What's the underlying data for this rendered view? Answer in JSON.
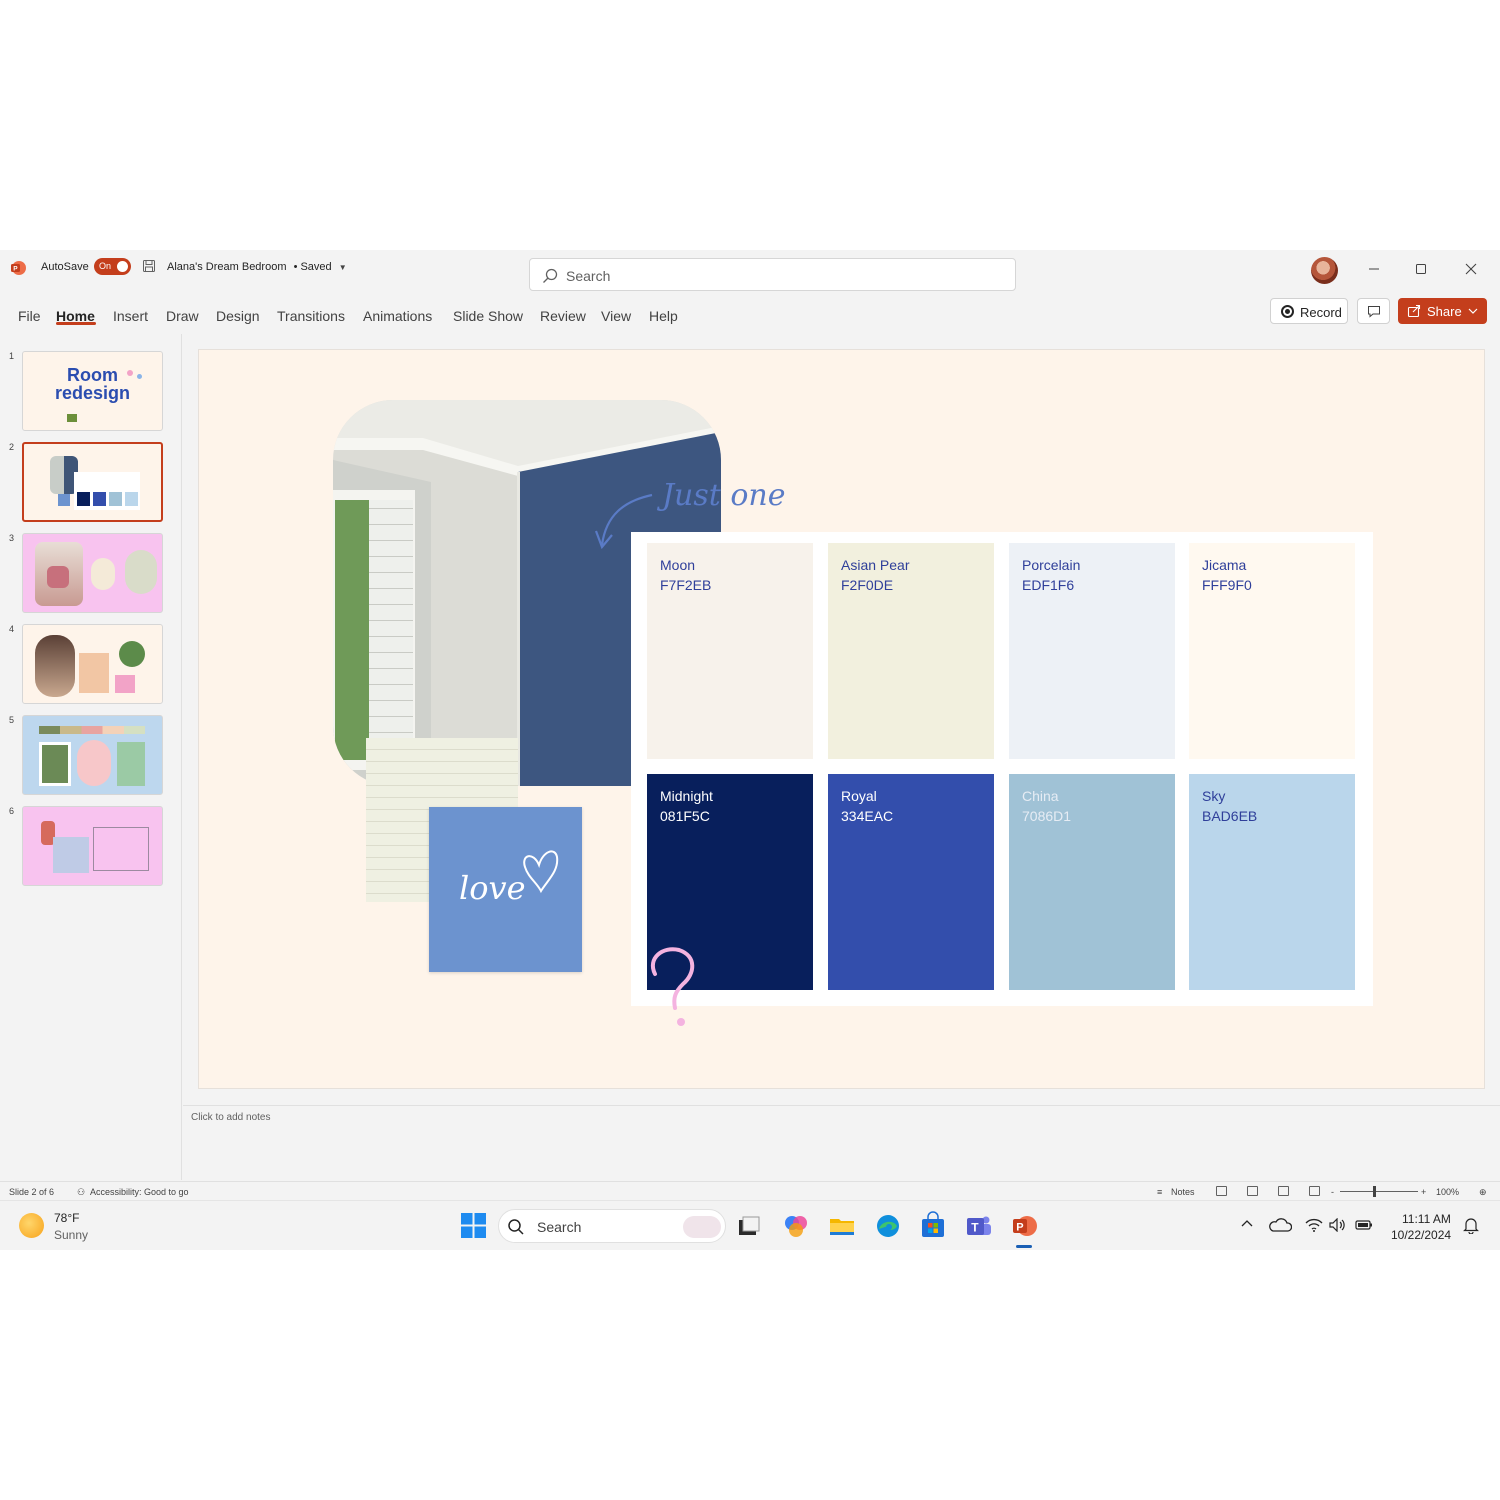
{
  "titlebar": {
    "autosave_label": "AutoSave",
    "autosave_state": "On",
    "document_title": "Alana's Dream Bedroom",
    "save_status": "• Saved",
    "search_placeholder": "Search"
  },
  "ribbon": {
    "tabs": [
      "File",
      "Home",
      "Insert",
      "Draw",
      "Design",
      "Transitions",
      "Animations",
      "Slide Show",
      "Review",
      "View",
      "Help"
    ],
    "active_tab": "Home",
    "record_label": "Record",
    "share_label": "Share"
  },
  "thumbnails": {
    "numbers": [
      "1",
      "2",
      "3",
      "4",
      "5",
      "6"
    ],
    "selected": 2,
    "slide1_title_line1": "Room",
    "slide1_title_line2": "redesign"
  },
  "slide": {
    "handwriting_top": "Just one",
    "handwriting_note": "love",
    "swatches": [
      {
        "name": "Moon",
        "hex": "F7F2EB",
        "color": "#F7F2EB"
      },
      {
        "name": "Asian Pear",
        "hex": "F2F0DE",
        "color": "#F2F0DE"
      },
      {
        "name": "Porcelain",
        "hex": "EDF1F6",
        "color": "#EDF1F6"
      },
      {
        "name": "Jicama",
        "hex": "FFF9F0",
        "color": "#FFF9F0"
      },
      {
        "name": "Midnight",
        "hex": "081F5C",
        "color": "#081F5C"
      },
      {
        "name": "Royal",
        "hex": "334EAC",
        "color": "#334EAC"
      },
      {
        "name": "China",
        "hex": "7086D1",
        "color": "#A0C2D6"
      },
      {
        "name": "Sky",
        "hex": "BAD6EB",
        "color": "#BAD6EB"
      }
    ]
  },
  "notes": {
    "placeholder": "Click to add notes"
  },
  "statusbar": {
    "slide_info": "Slide 2 of 6",
    "accessibility": "Accessibility: Good to go",
    "notes_label": "Notes",
    "zoom_minus": "-",
    "zoom_plus": "+",
    "zoom_level": "100%"
  },
  "taskbar": {
    "temperature": "78°F",
    "condition": "Sunny",
    "search_placeholder": "Search",
    "time": "11:11 AM",
    "date": "10/22/2024"
  },
  "colors": {
    "accent": "#c43e1c",
    "slide_bg": "#fef4ea"
  }
}
